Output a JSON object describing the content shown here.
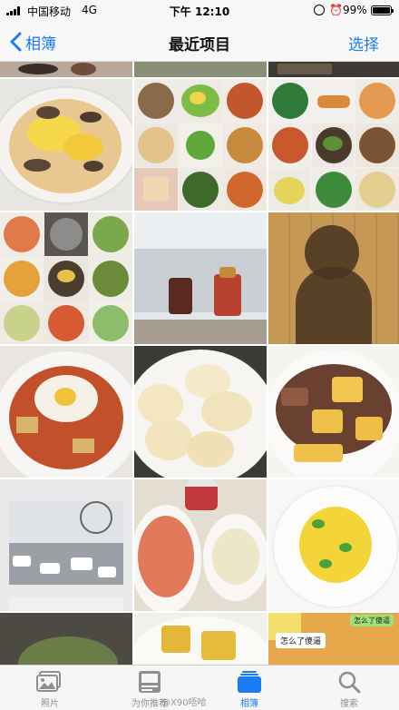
{
  "status_bar": {
    "carrier": "中国移动",
    "network": "4G",
    "time": "下午 12:10",
    "battery_percent": "99%",
    "battery_level": 0.99,
    "alarm_icon": "⏰"
  },
  "nav": {
    "back_label": "相簿",
    "title": "最近项目",
    "select_label": "选择"
  },
  "photos": {
    "meme_caption": "怎么了傻逼",
    "meme_corner_text": "怎么了傻逼"
  },
  "tabs": [
    {
      "label": "照片",
      "icon": "photos-icon",
      "active": false
    },
    {
      "label": "为你推荐",
      "icon": "for-you-icon",
      "active": false
    },
    {
      "label": "相簿",
      "icon": "albums-icon",
      "active": true
    },
    {
      "label": "搜索",
      "icon": "search-icon",
      "active": false
    }
  ],
  "watermark": "@X90唔哈",
  "colors": {
    "accent": "#1a7cf4",
    "tab_inactive": "#8e8e93",
    "bar_background": "#f7f7f7"
  }
}
